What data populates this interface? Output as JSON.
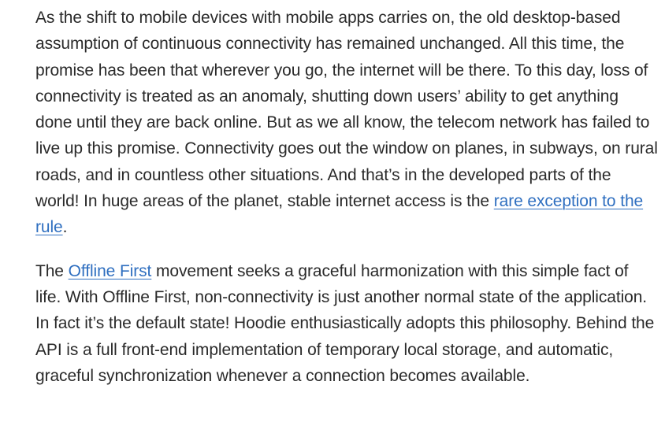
{
  "article": {
    "paragraph_1": {
      "text_before_link": "As the shift to mobile devices with mobile apps carries on, the old desktop-based assumption of continuous connectivity has remained unchanged. All this time, the promise has been that wherever you go, the internet will be there. To this day, loss of connectivity is treated as an anomaly, shutting down users’ ability to get anything done until they are back online. But as we all know, the telecom network has failed to live up this promise. Connectivity goes out the window on planes, in subways, on rural roads, and in countless other situations. And that’s in the developed parts of the world! In huge areas of the planet, stable internet access is the ",
      "link_text": "rare exception to the rule",
      "text_after_link": "."
    },
    "paragraph_2": {
      "text_before_link": "The ",
      "link_text": "Offline First",
      "text_after_link": " movement seeks a graceful harmonization with this simple fact of life. With Offline First, non-connectivity is just another normal state of the application. In fact it’s the default state! Hoodie enthusiastically adopts this philosophy. Behind the API is a full front-end implementation of temporary local storage, and automatic, graceful synchronization whenever a connection becomes available."
    }
  },
  "colors": {
    "text": "#2a2a2a",
    "link": "#2f6fc0",
    "background": "#ffffff"
  }
}
